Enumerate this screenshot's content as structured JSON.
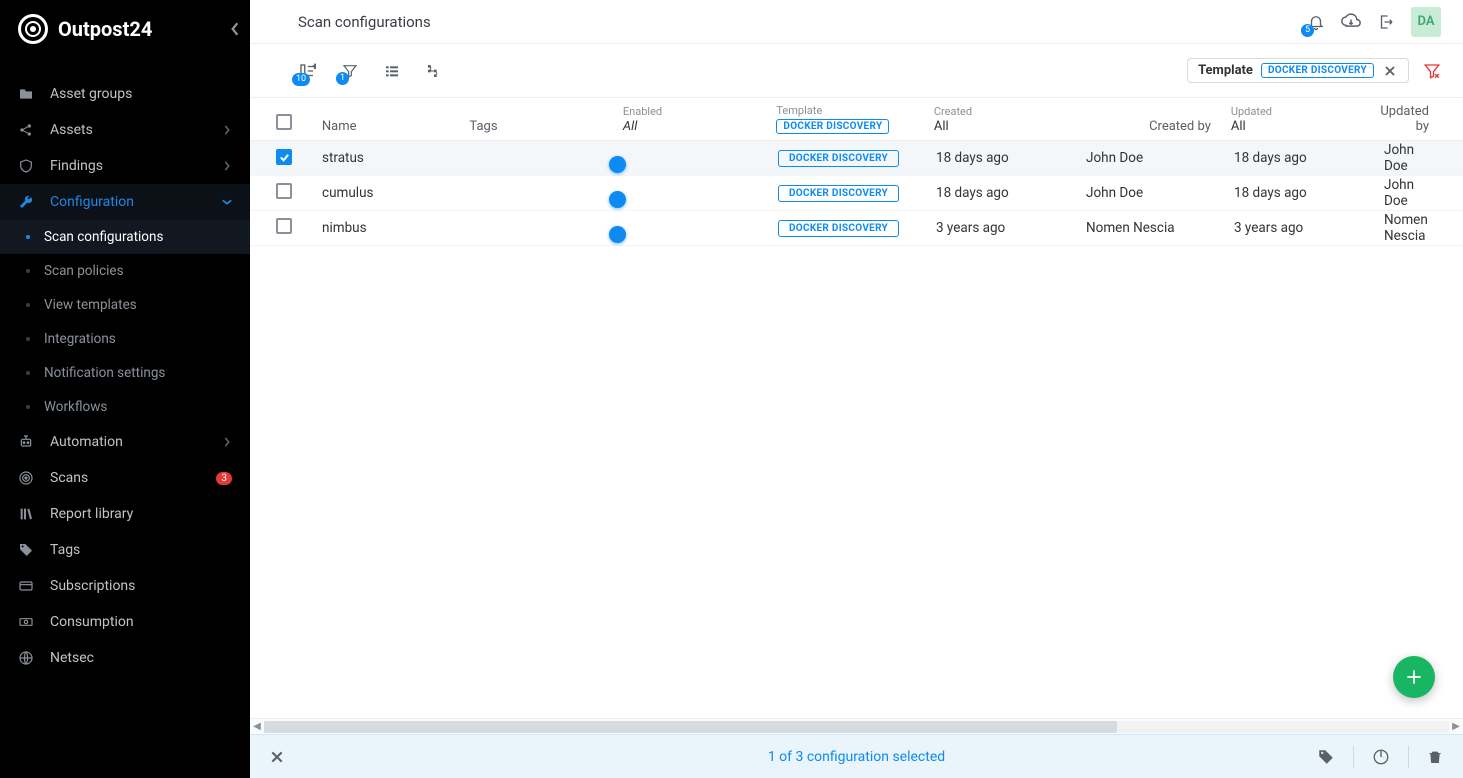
{
  "brand": "Outpost24",
  "header": {
    "title": "Scan configurations",
    "notifications_badge": "5",
    "avatar": "DA"
  },
  "toolbar": {
    "columns_badge": "10",
    "filter_badge": "1",
    "filter_chip_label": "Template",
    "filter_chip_value": "DOCKER DISCOVERY"
  },
  "columns": {
    "name": "Name",
    "tags": "Tags",
    "enabled_top": "Enabled",
    "enabled_bot": "All",
    "template_top": "Template",
    "template_tag": "DOCKER DISCOVERY",
    "created_top": "Created",
    "created_bot": "All",
    "created_by": "Created by",
    "updated_top": "Updated",
    "updated_bot": "All",
    "updated_by": "Updated by"
  },
  "rows": [
    {
      "checked": true,
      "name": "stratus",
      "template": "DOCKER DISCOVERY",
      "created": "18 days ago",
      "created_by": "John Doe",
      "updated": "18 days ago",
      "updated_by": "John Doe"
    },
    {
      "checked": false,
      "name": "cumulus",
      "template": "DOCKER DISCOVERY",
      "created": "18 days ago",
      "created_by": "John Doe",
      "updated": "18 days ago",
      "updated_by": "John Doe"
    },
    {
      "checked": false,
      "name": "nimbus",
      "template": "DOCKER DISCOVERY",
      "created": "3 years ago",
      "created_by": "Nomen Nescia",
      "updated": "3 years ago",
      "updated_by": "Nomen Nescia"
    }
  ],
  "selection_bar": {
    "message": "1 of 3 configuration selected"
  },
  "sidebar": {
    "items": [
      {
        "icon": "folder",
        "label": "Asset groups"
      },
      {
        "icon": "share",
        "label": "Assets",
        "chev": true
      },
      {
        "icon": "shield",
        "label": "Findings",
        "chev": true
      },
      {
        "icon": "wrench",
        "label": "Configuration",
        "chev_down": true,
        "active": true,
        "children": [
          {
            "label": "Scan configurations",
            "active": true
          },
          {
            "label": "Scan policies"
          },
          {
            "label": "View templates"
          },
          {
            "label": "Integrations"
          },
          {
            "label": "Notification settings"
          },
          {
            "label": "Workflows"
          }
        ]
      },
      {
        "icon": "robot",
        "label": "Automation",
        "chev": true
      },
      {
        "icon": "radar",
        "label": "Scans",
        "badge": "3"
      },
      {
        "icon": "library",
        "label": "Report library"
      },
      {
        "icon": "tag",
        "label": "Tags"
      },
      {
        "icon": "card",
        "label": "Subscriptions"
      },
      {
        "icon": "money",
        "label": "Consumption"
      },
      {
        "icon": "globe",
        "label": "Netsec"
      }
    ]
  }
}
